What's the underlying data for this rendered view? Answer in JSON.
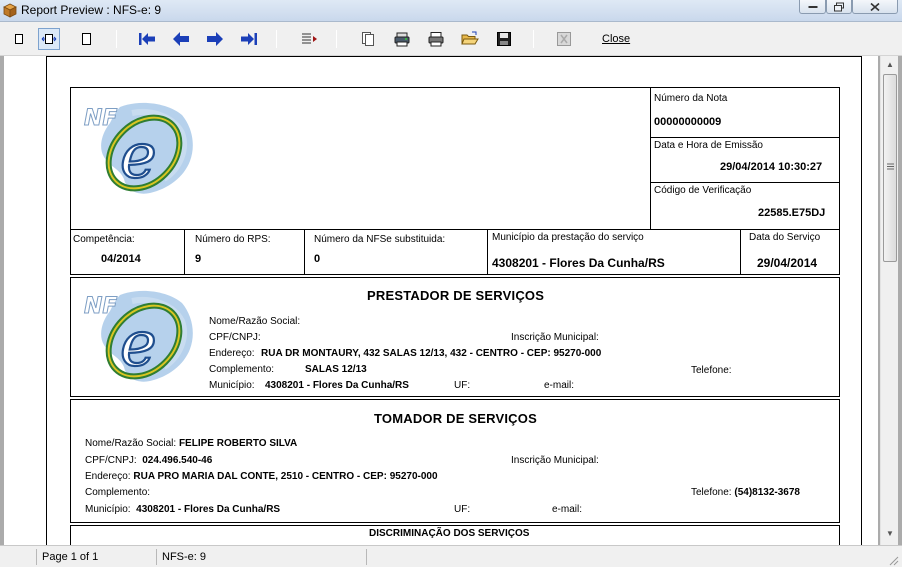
{
  "window": {
    "title": "Report Preview : NFS-e: 9"
  },
  "toolbar": {
    "close_label": "Close"
  },
  "status": {
    "page": "Page 1 of 1",
    "doc": "NFS-e: 9"
  },
  "report": {
    "numero_nota_label": "Número da Nota",
    "numero_nota_value": "00000000009",
    "data_emissao_label": "Data e Hora de Emissão",
    "data_emissao_value": "29/04/2014 10:30:27",
    "codigo_verificacao_label": "Código de Verificação",
    "codigo_verificacao_value": "22585.E75DJ",
    "competencia_label": "Competência:",
    "competencia_value": "04/2014",
    "numero_rps_label": "Número do RPS:",
    "numero_rps_value": "9",
    "nfse_substituida_label": "Número da NFSe substituida:",
    "nfse_substituida_value": "0",
    "municipio_prestacao_label": "Município da prestação do serviço",
    "municipio_prestacao_value": "4308201 - Flores Da Cunha/RS",
    "data_servico_label": "Data do Serviço",
    "data_servico_value": "29/04/2014",
    "prestador": {
      "title": "PRESTADOR DE SERVIÇOS",
      "nome_label": "Nome/Razão Social:",
      "nome_value": "",
      "cpf_label": "CPF/CNPJ:",
      "cpf_value": "",
      "inscricao_label": "Inscrição Municipal:",
      "inscricao_value": "",
      "endereco_label": "Endereço:",
      "endereco_value": "RUA DR MONTAURY, 432 SALAS 12/13, 432 - CENTRO - CEP: 95270-000",
      "complemento_label": "Complemento:",
      "complemento_value": "SALAS 12/13",
      "telefone_label": "Telefone:",
      "telefone_value": "",
      "municipio_label": "Município:",
      "municipio_value": "4308201 - Flores Da Cunha/RS",
      "uf_label": "UF:",
      "email_label": "e-mail:"
    },
    "tomador": {
      "title": "TOMADOR DE SERVIÇOS",
      "nome_label": "Nome/Razão Social:",
      "nome_value": "FELIPE ROBERTO SILVA",
      "cpf_label": "CPF/CNPJ:",
      "cpf_value": "024.496.540-46",
      "inscricao_label": "Inscrição Municipal:",
      "endereco_label": "Endereço:",
      "endereco_value": "RUA PRO MARIA DAL CONTE, 2510 - CENTRO - CEP: 95270-000",
      "complemento_label": "Complemento:",
      "telefone_label": "Telefone:",
      "telefone_value": "(54)8132-3678",
      "municipio_label": "Município:",
      "municipio_value": "4308201 - Flores Da Cunha/RS",
      "uf_label": "UF:",
      "email_label": "e-mail:"
    },
    "discriminacao_title": "DISCRIMINAÇÃO DOS SERVIÇOS"
  }
}
